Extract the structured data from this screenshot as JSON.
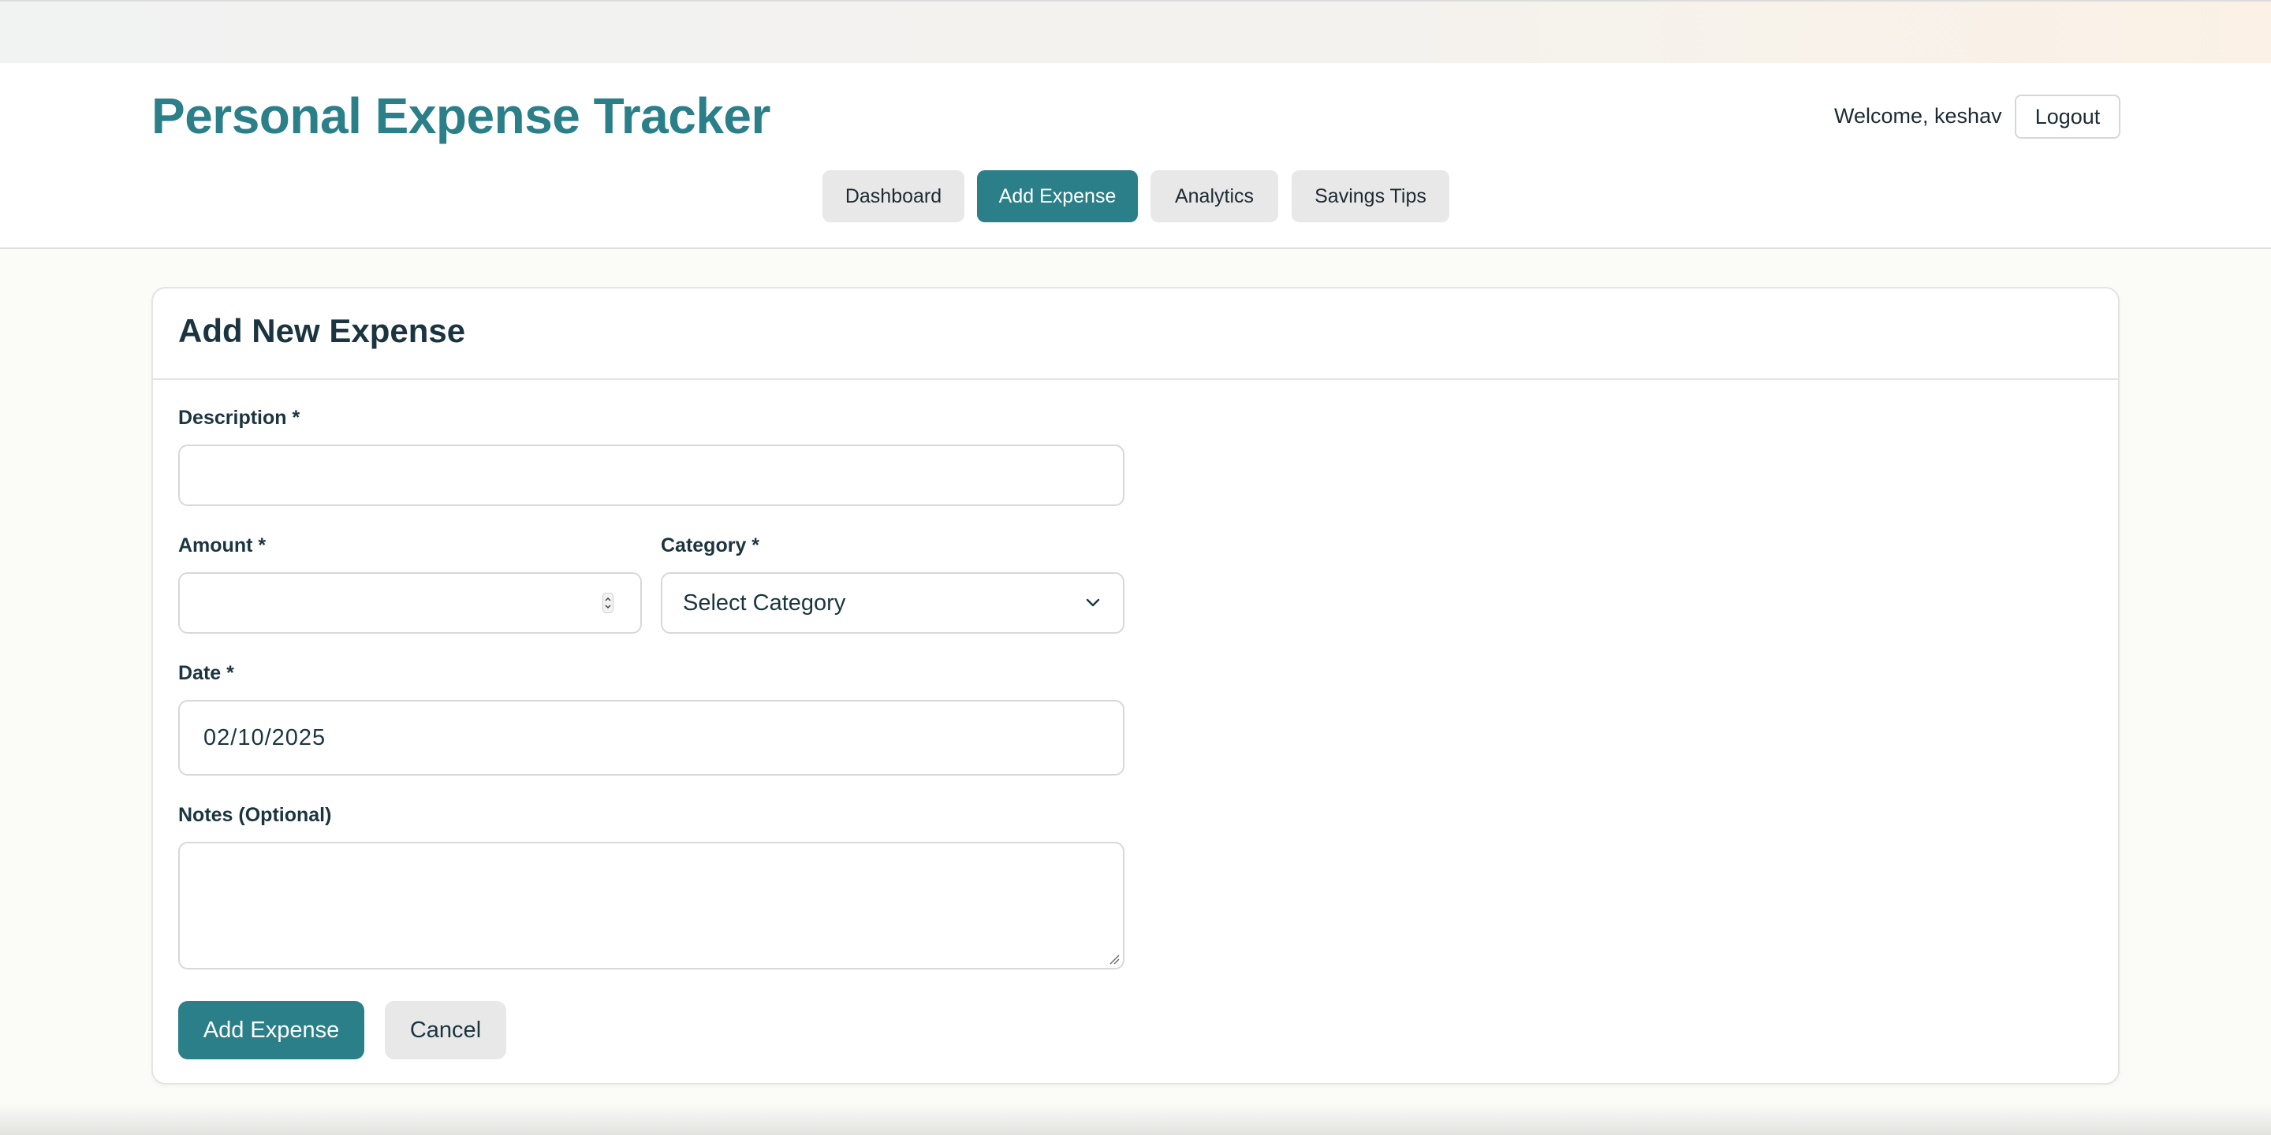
{
  "header": {
    "app_title": "Personal Expense Tracker",
    "welcome_text": "Welcome, keshav",
    "logout_label": "Logout"
  },
  "nav": {
    "tabs": [
      {
        "label": "Dashboard",
        "active": false
      },
      {
        "label": "Add Expense",
        "active": true
      },
      {
        "label": "Analytics",
        "active": false
      },
      {
        "label": "Savings Tips",
        "active": false
      }
    ]
  },
  "form": {
    "title": "Add New Expense",
    "description": {
      "label": "Description *",
      "value": "",
      "placeholder": ""
    },
    "amount": {
      "label": "Amount *",
      "value": "",
      "placeholder": ""
    },
    "category": {
      "label": "Category *",
      "selected": "Select Category"
    },
    "date": {
      "label": "Date *",
      "value": "02/10/2025"
    },
    "notes": {
      "label": "Notes (Optional)",
      "value": "",
      "placeholder": ""
    },
    "submit_label": "Add Expense",
    "cancel_label": "Cancel"
  },
  "colors": {
    "accent": "#2a7f88",
    "tab_inactive": "#e8e8e8",
    "text_dark": "#1b3540"
  },
  "icons": {
    "category_select": "chevron-down-icon",
    "amount_spinner": "spinner-arrows-icon",
    "notes_resize": "resize-grip-icon"
  }
}
